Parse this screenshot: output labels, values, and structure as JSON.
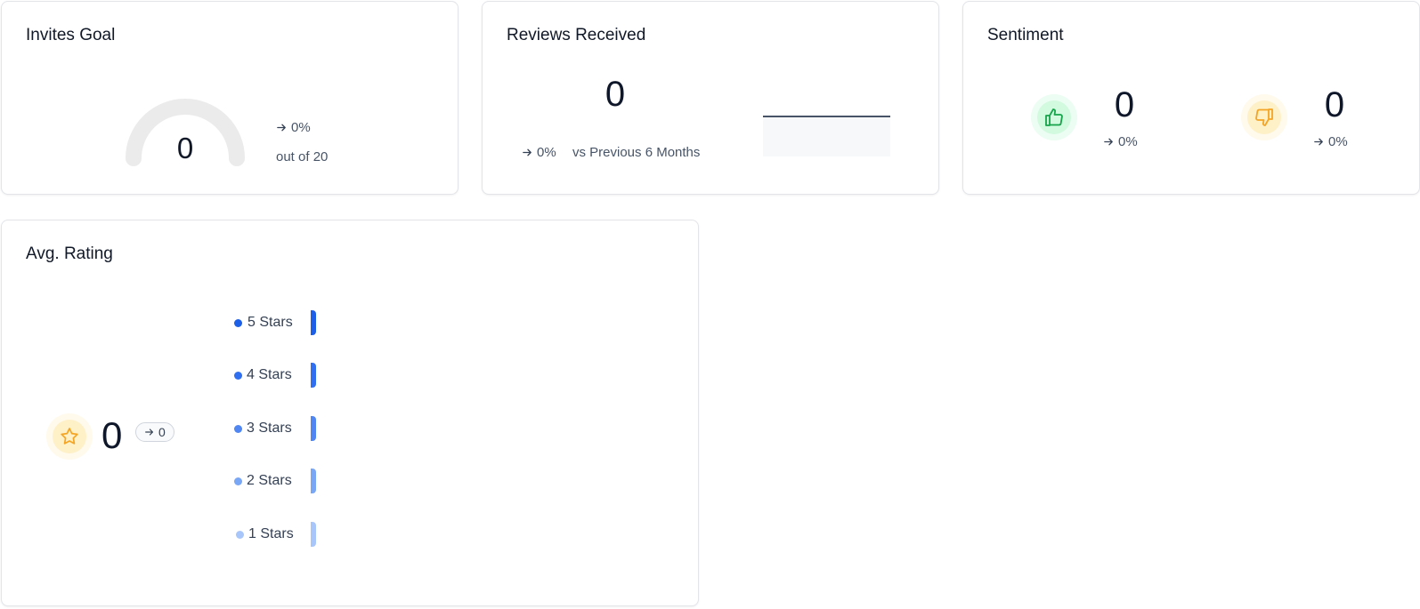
{
  "invites_goal": {
    "title": "Invites Goal",
    "value": "0",
    "trend": "0%",
    "subtitle": "out of 20",
    "progress_fraction": 0
  },
  "reviews_received": {
    "title": "Reviews Received",
    "value": "0",
    "trend": "0%",
    "comparison": "vs Previous 6 Months"
  },
  "sentiment": {
    "title": "Sentiment",
    "positive": {
      "value": "0",
      "trend": "0%"
    },
    "negative": {
      "value": "0",
      "trend": "0%"
    }
  },
  "avg_rating": {
    "title": "Avg. Rating",
    "value": "0",
    "change": "0",
    "rows": [
      {
        "label": "5 Stars",
        "color": "#1d5fe6"
      },
      {
        "label": "4 Stars",
        "color": "#2f6ff0"
      },
      {
        "label": "3 Stars",
        "color": "#4f86f2"
      },
      {
        "label": "2 Stars",
        "color": "#7aa6f6"
      },
      {
        "label": "1 Stars",
        "color": "#a9c6fa"
      }
    ]
  },
  "colors": {
    "positive": "#16a34a",
    "negative": "#f5a524",
    "gauge_track": "#ebebeb"
  }
}
